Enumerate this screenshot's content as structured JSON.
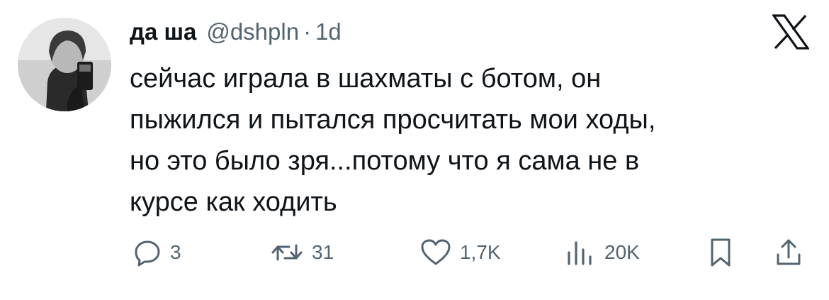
{
  "tweet": {
    "author": {
      "display_name": "да ша",
      "handle": "@dshpln",
      "separator": "·",
      "time": "1d"
    },
    "text_lines": [
      "сейчас играла в шахматы с ботом, он",
      "пыжился и пытался просчитать мои ходы,",
      "но это было зря...потому что я сама не в",
      "курсе как ходить"
    ],
    "actions": {
      "replies": "3",
      "reposts": "31",
      "likes": "1,7K",
      "views": "20K"
    }
  },
  "icons": {
    "brand": "x-logo-icon",
    "reply": "reply-icon",
    "repost": "repost-icon",
    "like": "heart-icon",
    "views": "views-chart-icon",
    "bookmark": "bookmark-icon",
    "share": "share-icon"
  },
  "colors": {
    "text": "#0f1419",
    "secondary": "#536471",
    "background": "#ffffff"
  }
}
